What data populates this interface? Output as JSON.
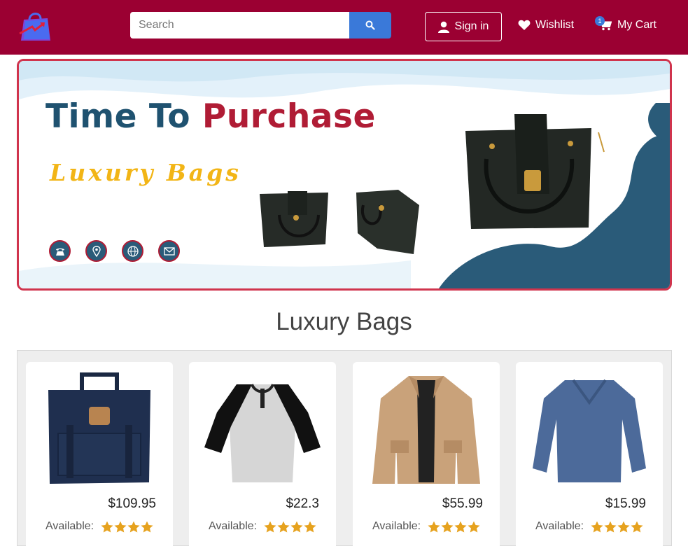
{
  "header": {
    "search_placeholder": "Search",
    "signin_label": "Sign in",
    "wishlist_label": "Wishlist",
    "cart_label": "My Cart",
    "cart_count": "1"
  },
  "banner": {
    "headline_part1": "Time To",
    "headline_part2": "Purchase",
    "subheadline": "Luxury Bags"
  },
  "section": {
    "title": "Luxury Bags"
  },
  "products": [
    {
      "price": "$109.95",
      "available_label": "Available:",
      "rating": 4
    },
    {
      "price": "$22.3",
      "available_label": "Available:",
      "rating": 4
    },
    {
      "price": "$55.99",
      "available_label": "Available:",
      "rating": 4
    },
    {
      "price": "$15.99",
      "available_label": "Available:",
      "rating": 4
    }
  ],
  "colors": {
    "header": "#9b0032",
    "accent": "#3a79d9",
    "star": "#e6a21e",
    "banner_border": "#d0344d"
  }
}
